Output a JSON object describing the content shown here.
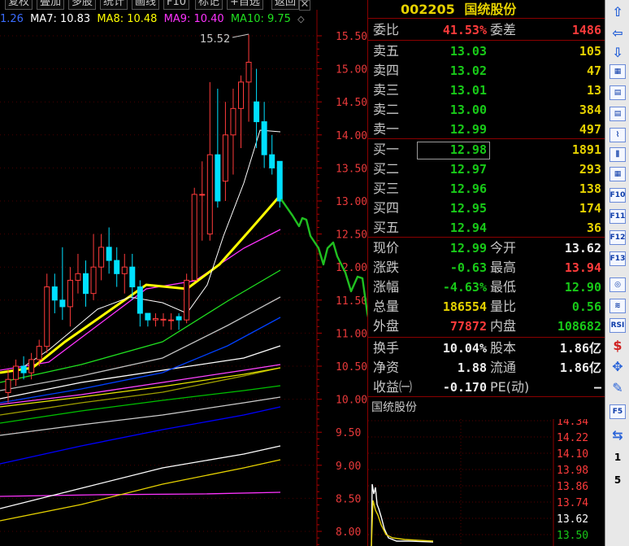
{
  "toolbar": {
    "buttons": [
      "复权",
      "叠加",
      "多股",
      "统计",
      "画线",
      "F10",
      "标记",
      "+自选",
      "返回"
    ]
  },
  "ma_legend": [
    {
      "text": "1.26",
      "color": "#3a6cff"
    },
    {
      "text": "MA7: 10.83",
      "color": "#ffffff"
    },
    {
      "text": "MA8: 10.48",
      "color": "#ffff00"
    },
    {
      "text": "MA9: 10.40",
      "color": "#ff33ff"
    },
    {
      "text": "MA10: 9.75",
      "color": "#20e020"
    }
  ],
  "chart_data": {
    "type": "candlestick",
    "y_ticks": [
      "15.50",
      "15.00",
      "14.50",
      "14.00",
      "13.50",
      "13.00",
      "12.50",
      "12.00",
      "11.50",
      "11.00",
      "10.50",
      "10.00",
      "9.50",
      "9.00",
      "8.50",
      "8.00"
    ],
    "ylim": [
      7.85,
      15.85
    ],
    "peak_label": "15.52",
    "candles": [
      {
        "o": 10.1,
        "c": 10.3,
        "h": 10.45,
        "l": 9.95
      },
      {
        "o": 10.3,
        "c": 10.5,
        "h": 10.6,
        "l": 10.2
      },
      {
        "o": 10.5,
        "c": 10.4,
        "h": 10.65,
        "l": 10.3
      },
      {
        "o": 10.4,
        "c": 10.6,
        "h": 10.7,
        "l": 10.3
      },
      {
        "o": 10.6,
        "c": 10.8,
        "h": 10.9,
        "l": 10.5
      },
      {
        "o": 10.8,
        "c": 11.7,
        "h": 11.9,
        "l": 10.7
      },
      {
        "o": 11.7,
        "c": 11.5,
        "h": 11.9,
        "l": 11.3
      },
      {
        "o": 11.5,
        "c": 11.4,
        "h": 12.3,
        "l": 11.2
      },
      {
        "o": 11.4,
        "c": 11.8,
        "h": 12.0,
        "l": 11.1
      },
      {
        "o": 11.8,
        "c": 11.9,
        "h": 12.2,
        "l": 11.6
      },
      {
        "o": 11.9,
        "c": 11.6,
        "h": 12.1,
        "l": 11.4
      },
      {
        "o": 11.6,
        "c": 12.0,
        "h": 12.5,
        "l": 11.5
      },
      {
        "o": 12.0,
        "c": 12.3,
        "h": 12.5,
        "l": 11.8
      },
      {
        "o": 12.3,
        "c": 12.1,
        "h": 12.6,
        "l": 11.9
      },
      {
        "o": 12.1,
        "c": 11.9,
        "h": 12.3,
        "l": 11.7
      },
      {
        "o": 11.9,
        "c": 12.0,
        "h": 12.2,
        "l": 11.6
      },
      {
        "o": 12.0,
        "c": 11.7,
        "h": 12.2,
        "l": 11.5
      },
      {
        "o": 11.7,
        "c": 11.3,
        "h": 11.8,
        "l": 11.1
      },
      {
        "o": 11.3,
        "c": 11.2,
        "h": 11.3,
        "l": 11.1
      },
      {
        "o": 11.2,
        "c": 11.22,
        "h": 11.3,
        "l": 11.1
      },
      {
        "o": 11.2,
        "c": 11.21,
        "h": 11.3,
        "l": 11.1
      },
      {
        "o": 11.2,
        "c": 11.2,
        "h": 11.3,
        "l": 11.05
      },
      {
        "o": 11.25,
        "c": 11.2,
        "h": 11.3,
        "l": 11.05
      },
      {
        "o": 11.2,
        "c": 11.8,
        "h": 11.9,
        "l": 11.15
      },
      {
        "o": 11.8,
        "c": 13.1,
        "h": 13.2,
        "l": 11.8
      },
      {
        "o": 13.1,
        "c": 13.1,
        "h": 13.6,
        "l": 12.4
      },
      {
        "o": 12.5,
        "c": 13.7,
        "h": 14.8,
        "l": 12.4
      },
      {
        "o": 13.7,
        "c": 13.0,
        "h": 14.7,
        "l": 12.9
      },
      {
        "o": 13.3,
        "c": 14.0,
        "h": 14.5,
        "l": 13.0
      },
      {
        "o": 14.0,
        "c": 14.4,
        "h": 14.7,
        "l": 13.4
      },
      {
        "o": 14.4,
        "c": 14.8,
        "h": 14.9,
        "l": 13.8
      },
      {
        "o": 14.8,
        "c": 15.1,
        "h": 15.52,
        "l": 14.2
      },
      {
        "o": 14.5,
        "c": 14.2,
        "h": 15.0,
        "l": 13.8
      },
      {
        "o": 14.2,
        "c": 13.7,
        "h": 14.5,
        "l": 13.5
      },
      {
        "o": 13.7,
        "c": 13.5,
        "h": 14.0,
        "l": 13.4
      },
      {
        "o": 13.6,
        "c": 13.0,
        "h": 13.6,
        "l": 12.9
      }
    ]
  },
  "panel": {
    "code": "002205",
    "name": "国统股份",
    "weibi_label": "委比",
    "weibi": "41.53%",
    "weicha_label": "委差",
    "weicha": "1486",
    "sells": [
      {
        "label": "卖五",
        "price": "13.03",
        "vol": "105"
      },
      {
        "label": "卖四",
        "price": "13.02",
        "vol": "47"
      },
      {
        "label": "卖三",
        "price": "13.01",
        "vol": "13"
      },
      {
        "label": "卖二",
        "price": "13.00",
        "vol": "384"
      },
      {
        "label": "卖一",
        "price": "12.99",
        "vol": "497"
      }
    ],
    "buys": [
      {
        "label": "买一",
        "price": "12.98",
        "vol": "1891"
      },
      {
        "label": "买二",
        "price": "12.97",
        "vol": "293"
      },
      {
        "label": "买三",
        "price": "12.96",
        "vol": "138"
      },
      {
        "label": "买四",
        "price": "12.95",
        "vol": "174"
      },
      {
        "label": "买五",
        "price": "12.94",
        "vol": "36"
      }
    ],
    "stats": [
      {
        "l1": "现价",
        "v1": "12.99",
        "c1": "green",
        "l2": "今开",
        "v2": "13.62",
        "c2": "white"
      },
      {
        "l1": "涨跌",
        "v1": "-0.63",
        "c1": "green",
        "l2": "最高",
        "v2": "13.94",
        "c2": "red"
      },
      {
        "l1": "涨幅",
        "v1": "-4.63%",
        "c1": "green",
        "l2": "最低",
        "v2": "12.90",
        "c2": "green"
      },
      {
        "l1": "总量",
        "v1": "186554",
        "c1": "yellow",
        "l2": "量比",
        "v2": "0.56",
        "c2": "green"
      },
      {
        "l1": "外盘",
        "v1": "77872",
        "c1": "red",
        "l2": "内盘",
        "v2": "108682",
        "c2": "green"
      }
    ],
    "stats2": [
      {
        "l1": "换手",
        "v1": "10.04%",
        "l2": "股本",
        "v2": "1.86亿"
      },
      {
        "l1": "净资",
        "v1": "1.88",
        "l2": "流通",
        "v2": "1.86亿"
      },
      {
        "l1": "收益㈠",
        "v1": "-0.170",
        "l2": "PE(动)",
        "v2": "–"
      }
    ],
    "mini_title": "国统股份",
    "mini_ticks": [
      {
        "t": "14.34",
        "c": "red"
      },
      {
        "t": "14.22",
        "c": "red"
      },
      {
        "t": "14.10",
        "c": "red"
      },
      {
        "t": "13.98",
        "c": "red"
      },
      {
        "t": "13.86",
        "c": "red"
      },
      {
        "t": "13.74",
        "c": "red"
      },
      {
        "t": "13.62",
        "c": "white"
      },
      {
        "t": "13.50",
        "c": "green"
      }
    ]
  },
  "sidebar": {
    "items": [
      "⇧",
      "⇦",
      "⇩",
      "▦",
      "▤",
      "▤",
      "⌇",
      "⫼",
      "▦",
      "F10",
      "F11",
      "F12",
      "F13",
      "◎",
      "≋",
      "RSI",
      "$",
      "✥",
      "✎",
      "F5",
      "⇆",
      "1",
      "5"
    ]
  }
}
